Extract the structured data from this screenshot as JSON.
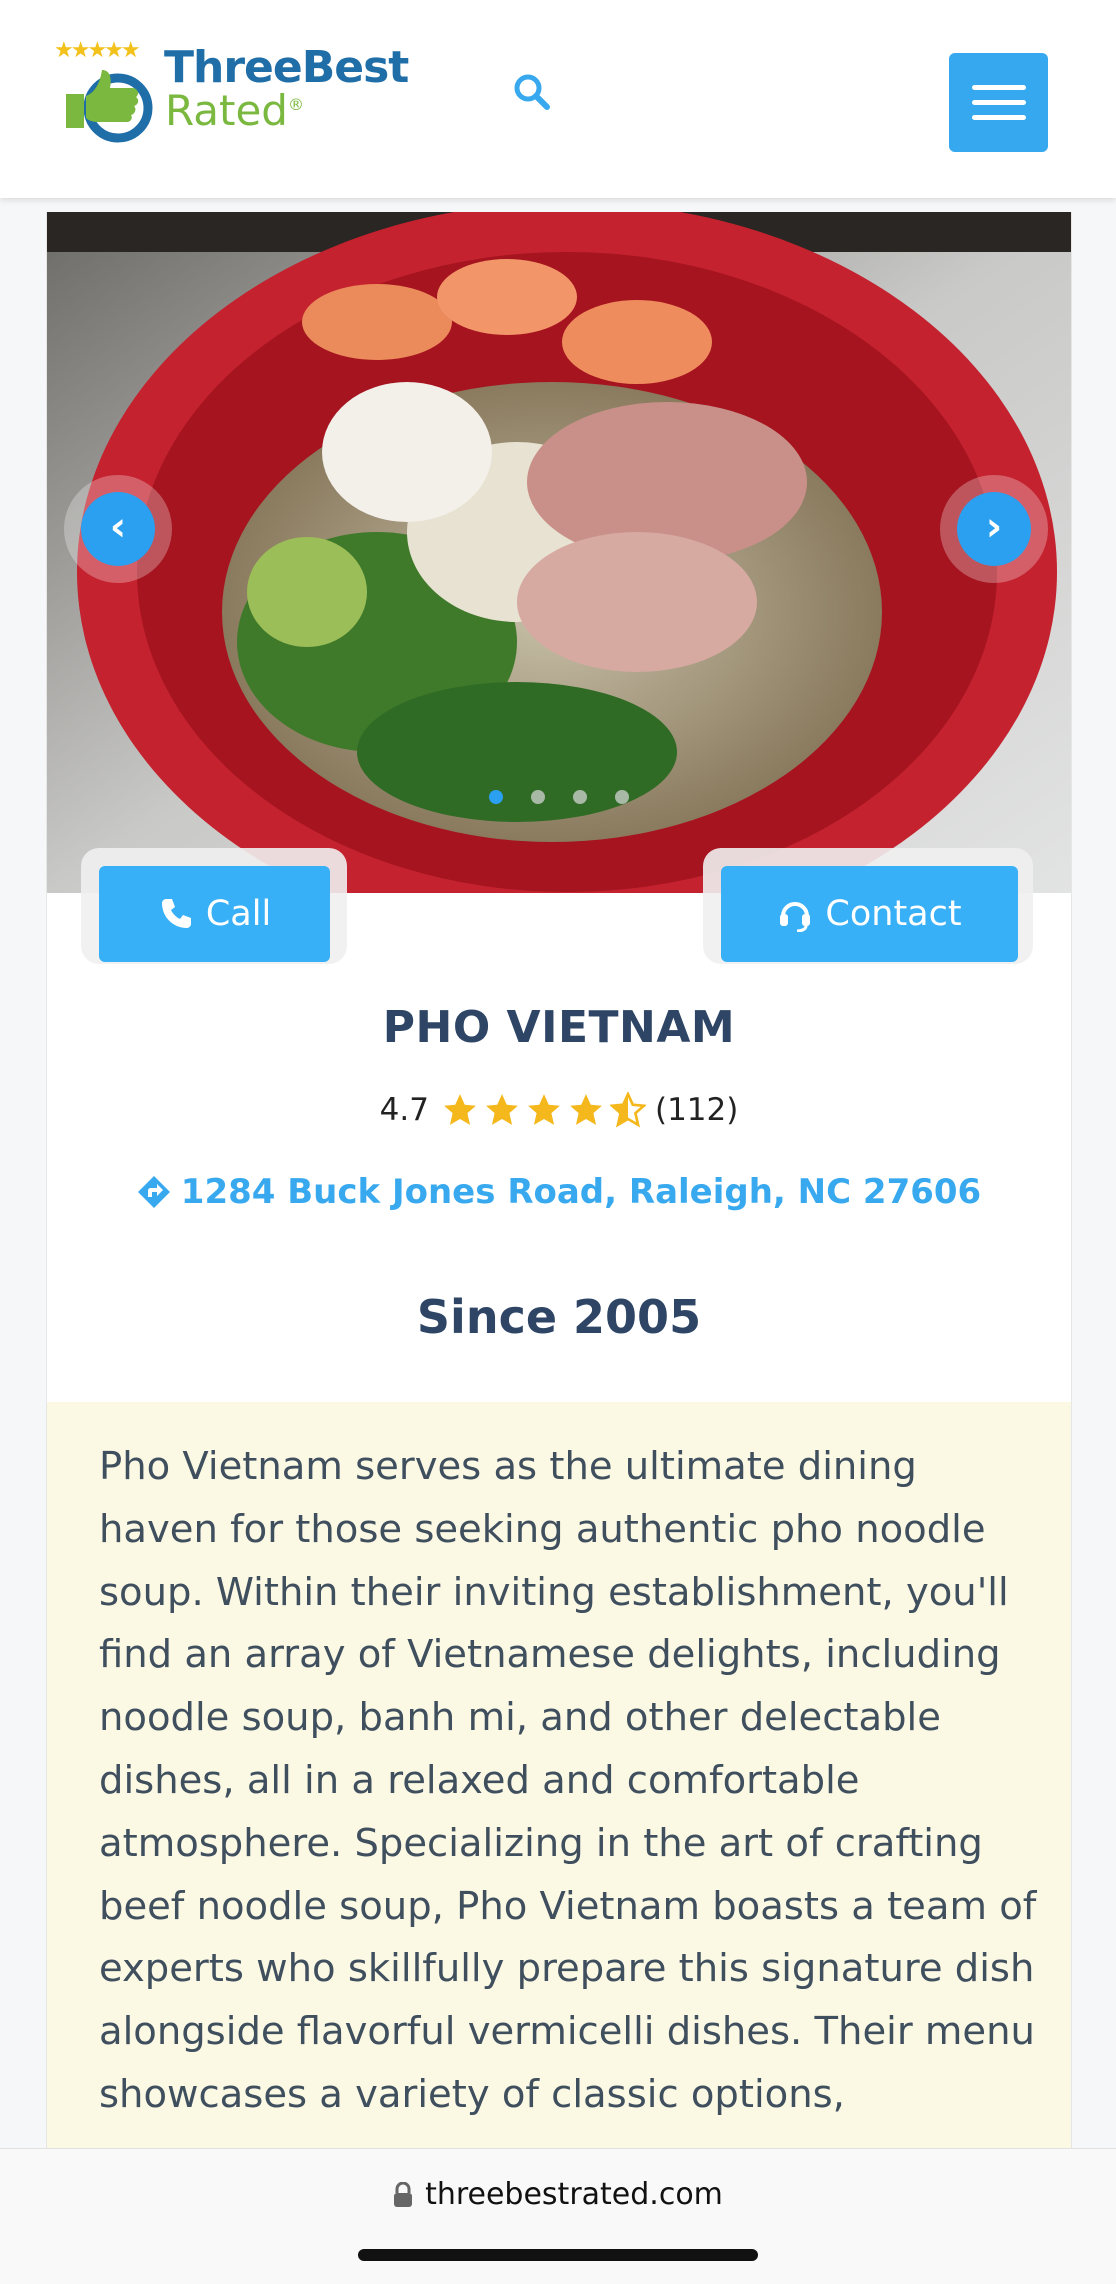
{
  "site": {
    "logo_word1": "ThreeBest",
    "logo_word2": "Rated",
    "logo_reg": "®",
    "brand_color": "#1f6ea8",
    "accent_color": "#38b0f7"
  },
  "header": {
    "search_icon": "search-icon",
    "menu_icon": "hamburger-icon"
  },
  "listing": {
    "photo_alt": "Bowl of pho with shrimp, squid, pork and herbs",
    "carousel": {
      "slide_count": 4,
      "active_index": 0
    },
    "call_label": "Call",
    "contact_label": "Contact",
    "name": "PHO VIETNAM",
    "rating_value": "4.7",
    "rating_stars": 4.5,
    "review_count": "(112)",
    "address": "1284 Buck Jones Road, Raleigh, NC 27606",
    "since": "Since 2005",
    "description": "Pho Vietnam serves as the ultimate dining haven for those seeking authentic pho noodle soup. Within their inviting establishment, you'll find an array of Vietnamese delights, including noodle soup, banh mi, and other delectable dishes, all in a relaxed and comfortable atmosphere. Specializing in the art of crafting beef noodle soup, Pho Vietnam boasts a team of experts who skillfully prepare this signature dish alongside flavorful vermicelli dishes. Their menu showcases a variety of classic options,"
  },
  "browser": {
    "url": "threebestrated.com"
  }
}
